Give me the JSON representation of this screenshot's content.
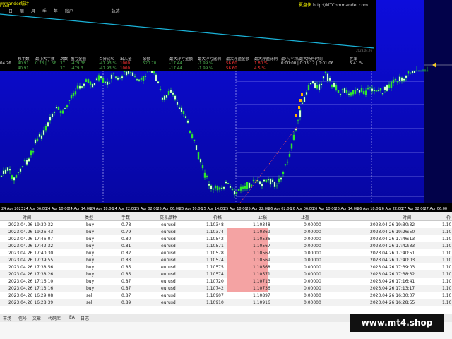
{
  "overlay": {
    "title": "mmander统计",
    "title2": "r and",
    "menu": [
      "日",
      "周",
      "月",
      "季",
      "年",
      "账户",
      "轨迹"
    ],
    "site_a": "夏盘侠",
    "site_b": "http://MTCommander.com",
    "date": "2023.04.26",
    "headers": [
      "总手数",
      "最小大手数",
      "次数",
      "盈亏金额",
      "胜比",
      "百分比%",
      "出入金",
      "余额",
      "最大浮亏金额",
      "最大浮亏比例",
      "最大浮盈金额",
      "最大浮盈比例",
      "最小/平均/最大持仓时间",
      "胜率"
    ],
    "row1": [
      "04.26",
      "40.91",
      "0.78 | 1.56",
      "37",
      "-479.38",
      "",
      "-47.93 %",
      "1000",
      "520.70",
      "-17.44",
      "-1.99 %",
      "56.60",
      "1.80 %",
      "0:00:00 | 0:03:12 | 0:01:06",
      "5.41 %"
    ],
    "row2": [
      "40.91",
      "",
      "37",
      "-479.3",
      "",
      "-47.93 %",
      "1000",
      "",
      "-17.44",
      "-1.99 %",
      "56.60",
      "4.5 %",
      "",
      ""
    ]
  },
  "chart": {
    "x_labels": [
      "24 Apr 2023",
      "24 Apr 06:00",
      "24 Apr 10:00",
      "24 Apr 14:00",
      "24 Apr 18:00",
      "24 Apr 22:00",
      "25 Apr 02:00",
      "25 Apr 06:00",
      "25 Apr 10:00",
      "25 Apr 14:00",
      "25 Apr 18:00",
      "25 Apr 22:00",
      "26 Apr 02:00",
      "26 Apr 06:00",
      "26 Apr 10:00",
      "26 Apr 14:00",
      "26 Apr 18:00",
      "26 Apr 22:00",
      "27 Apr 02:00",
      "27 Apr 06:00"
    ],
    "bg_top": "#0b0bd8",
    "bg_bottom": "#06069a",
    "candle_color": "#2ee62e"
  },
  "table": {
    "headers": [
      "时间",
      "类型",
      "手数",
      "交易品种",
      "价格",
      "止损",
      "止盈",
      "时间",
      "价"
    ],
    "rows": [
      {
        "time": "2023.04.26 19:30:32",
        "type": "buy",
        "lots": "0.78",
        "symbol": "eurusd",
        "price": "1.10348",
        "sl": "1.10348",
        "tp": "0.00000",
        "time2": "2023.04.26 19:30:32",
        "price2": "1.10"
      },
      {
        "time": "2023.04.26 19:26:43",
        "type": "buy",
        "lots": "0.79",
        "symbol": "eurusd",
        "price": "1.10374",
        "sl": "1.10369",
        "tp": "0.00000",
        "time2": "2023.04.26 19:26:50",
        "price2": "1.10"
      },
      {
        "time": "2023.04.26 17:46:07",
        "type": "buy",
        "lots": "0.80",
        "symbol": "eurusd",
        "price": "1.10542",
        "sl": "1.10536",
        "tp": "0.00000",
        "time2": "2023.04.26 17:46:13",
        "price2": "1.10"
      },
      {
        "time": "2023.04.26 17:42:32",
        "type": "buy",
        "lots": "0.81",
        "symbol": "eurusd",
        "price": "1.10571",
        "sl": "1.10567",
        "tp": "0.00000",
        "time2": "2023.04.26 17:42:33",
        "price2": "1.10"
      },
      {
        "time": "2023.04.26 17:40:30",
        "type": "buy",
        "lots": "0.82",
        "symbol": "eurusd",
        "price": "1.10578",
        "sl": "1.10567",
        "tp": "0.00000",
        "time2": "2023.04.26 17:40:51",
        "price2": "1.10"
      },
      {
        "time": "2023.04.26 17:39:55",
        "type": "buy",
        "lots": "0.83",
        "symbol": "eurusd",
        "price": "1.10574",
        "sl": "1.10569",
        "tp": "0.00000",
        "time2": "2023.04.26 17:40:03",
        "price2": "1.10"
      },
      {
        "time": "2023.04.26 17:38:56",
        "type": "buy",
        "lots": "0.85",
        "symbol": "eurusd",
        "price": "1.10575",
        "sl": "1.10568",
        "tp": "0.00000",
        "time2": "2023.04.26 17:39:03",
        "price2": "1.10"
      },
      {
        "time": "2023.04.26 17:38:26",
        "type": "buy",
        "lots": "0.85",
        "symbol": "eurusd",
        "price": "1.10574",
        "sl": "1.10571",
        "tp": "0.00000",
        "time2": "2023.04.26 17:38:32",
        "price2": "1.10"
      },
      {
        "time": "2023.04.26 17:16:10",
        "type": "buy",
        "lots": "0.87",
        "symbol": "eurusd",
        "price": "1.10720",
        "sl": "1.10713",
        "tp": "0.00000",
        "time2": "2023.04.26 17:16:41",
        "price2": "1.10"
      },
      {
        "time": "2023.04.26 17:13:16",
        "type": "buy",
        "lots": "0.87",
        "symbol": "eurusd",
        "price": "1.10742",
        "sl": "1.10736",
        "tp": "0.00000",
        "time2": "2023.04.26 17:13:17",
        "price2": "1.10"
      },
      {
        "time": "2023.04.26 16:29:08",
        "type": "sell",
        "lots": "0.87",
        "symbol": "eurusd",
        "price": "1.10907",
        "sl": "1.10897",
        "tp": "0.00000",
        "time2": "2023.04.26 16:30:07",
        "price2": "1.10"
      },
      {
        "time": "2023.04.26 16:28:39",
        "type": "sell",
        "lots": "0.89",
        "symbol": "eurusd",
        "price": "1.10910",
        "sl": "1.10916",
        "tp": "0.00000",
        "time2": "2023.04.26 16:28:55",
        "price2": "1.10"
      }
    ]
  },
  "tabs": [
    "市场",
    "信号",
    "文章",
    "代码库",
    "EA",
    "日志"
  ],
  "watermark": "www.mt4.shop",
  "colors": {
    "sl_highlight": "#f4a3a3",
    "chart_bg": "#0b0bd8"
  }
}
